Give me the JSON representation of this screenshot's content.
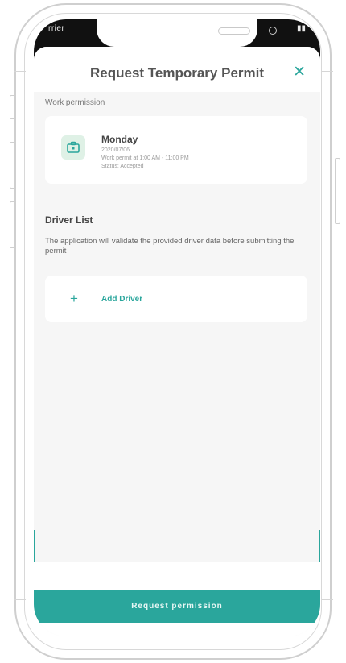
{
  "status_bar": {
    "carrier": "rrier",
    "right": ""
  },
  "header": {
    "title": "Request Temporary Permit",
    "close_icon": "close-icon"
  },
  "work_permission": {
    "section_label": "Work permission",
    "card": {
      "icon": "briefcase-icon",
      "day": "Monday",
      "date": "2020/07/06",
      "hours": "Work permit at 1:00 AM - 11:00 PM",
      "status": "Status: Accepted"
    }
  },
  "driver_list": {
    "heading": "Driver List",
    "description": "The application will validate the provided driver data before submitting the permit",
    "add_icon": "plus-icon",
    "add_label": "Add Driver"
  },
  "footer": {
    "request_label": "Request permission"
  },
  "colors": {
    "accent": "#2aa69c",
    "icon_bg": "#dff1e6"
  }
}
